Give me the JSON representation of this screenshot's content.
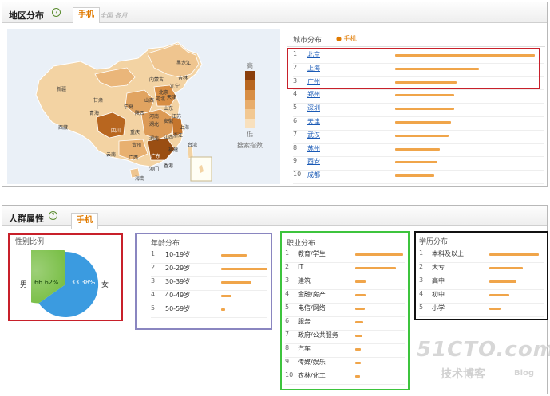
{
  "region": {
    "title": "地区分布",
    "help": "?",
    "active_tab": "手机",
    "inactive_tabs": "全国 各月",
    "map_legend": {
      "high": "高",
      "low": "低",
      "metric": "搜索指数"
    },
    "map_labels": [
      "黑龙江",
      "吉林",
      "辽宁",
      "内蒙古",
      "新疆",
      "西藏",
      "青海",
      "甘肃",
      "宁夏",
      "山西",
      "河北",
      "北京",
      "天津",
      "山东",
      "河南",
      "陕西",
      "四川",
      "重庆",
      "湖北",
      "安徽",
      "江苏",
      "上海",
      "浙江",
      "湖南",
      "江西",
      "贵州",
      "云南",
      "广西",
      "广东",
      "福建",
      "台湾",
      "海南",
      "香港",
      "澳门"
    ],
    "city_header": "城市分布",
    "city_legend": "手机",
    "cities": [
      {
        "n": "1",
        "name": "北京",
        "v": 1.0
      },
      {
        "n": "2",
        "name": "上海",
        "v": 0.6
      },
      {
        "n": "3",
        "name": "广州",
        "v": 0.44
      },
      {
        "n": "4",
        "name": "郑州",
        "v": 0.42
      },
      {
        "n": "5",
        "name": "深圳",
        "v": 0.42
      },
      {
        "n": "6",
        "name": "天津",
        "v": 0.4
      },
      {
        "n": "7",
        "name": "武汉",
        "v": 0.38
      },
      {
        "n": "8",
        "name": "苏州",
        "v": 0.32
      },
      {
        "n": "9",
        "name": "西安",
        "v": 0.3
      },
      {
        "n": "10",
        "name": "成都",
        "v": 0.28
      }
    ]
  },
  "crowd": {
    "title": "人群属性",
    "help": "?",
    "active_tab": "手机",
    "gender": {
      "title": "性别比例",
      "male_label": "男",
      "female_label": "女",
      "male_pct": "66.62%",
      "female_pct": "33.38%",
      "male_color": "#7cc04a",
      "female_color": "#3b9be0"
    },
    "age": {
      "title": "年龄分布",
      "items": [
        {
          "n": "1",
          "label": "10-19岁",
          "v": 0.55
        },
        {
          "n": "2",
          "label": "20-29岁",
          "v": 1.0
        },
        {
          "n": "3",
          "label": "30-39岁",
          "v": 0.65
        },
        {
          "n": "4",
          "label": "40-49岁",
          "v": 0.22
        },
        {
          "n": "5",
          "label": "50-59岁",
          "v": 0.08
        }
      ]
    },
    "job": {
      "title": "职业分布",
      "items": [
        {
          "n": "1",
          "label": "教育/学生",
          "v": 1.0
        },
        {
          "n": "2",
          "label": "IT",
          "v": 0.85
        },
        {
          "n": "3",
          "label": "建筑",
          "v": 0.22
        },
        {
          "n": "4",
          "label": "金融/房产",
          "v": 0.22
        },
        {
          "n": "5",
          "label": "电信/网络",
          "v": 0.2
        },
        {
          "n": "6",
          "label": "服务",
          "v": 0.17
        },
        {
          "n": "7",
          "label": "政府/公共服务",
          "v": 0.15
        },
        {
          "n": "8",
          "label": "汽车",
          "v": 0.12
        },
        {
          "n": "9",
          "label": "传媒/娱乐",
          "v": 0.12
        },
        {
          "n": "10",
          "label": "农林/化工",
          "v": 0.1
        }
      ]
    },
    "edu": {
      "title": "学历分布",
      "items": [
        {
          "n": "1",
          "label": "本科及以上",
          "v": 1.0
        },
        {
          "n": "2",
          "label": "大专",
          "v": 0.68
        },
        {
          "n": "3",
          "label": "高中",
          "v": 0.55
        },
        {
          "n": "4",
          "label": "初中",
          "v": 0.4
        },
        {
          "n": "5",
          "label": "小学",
          "v": 0.22
        }
      ]
    }
  },
  "watermark": {
    "brand": "51CTO.com",
    "sub": "技术博客",
    "blog": "Blog"
  },
  "colors": {
    "bar": "#f0a54a",
    "link": "#1a5ab6",
    "red_box": "#c8202a",
    "purple_box": "#8a86c0",
    "green_box": "#3dc43d",
    "black_box": "#111111"
  }
}
